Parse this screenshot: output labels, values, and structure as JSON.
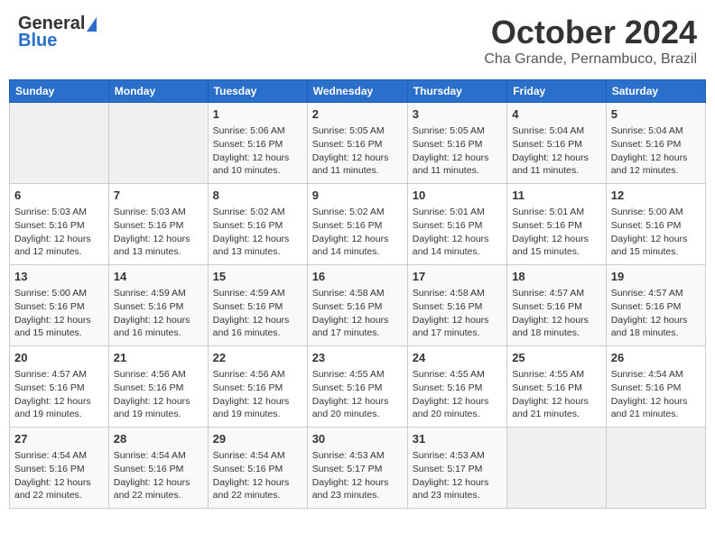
{
  "header": {
    "logo_general": "General",
    "logo_blue": "Blue",
    "month_title": "October 2024",
    "location": "Cha Grande, Pernambuco, Brazil"
  },
  "days_of_week": [
    "Sunday",
    "Monday",
    "Tuesday",
    "Wednesday",
    "Thursday",
    "Friday",
    "Saturday"
  ],
  "weeks": [
    [
      {
        "day": "",
        "content": ""
      },
      {
        "day": "",
        "content": ""
      },
      {
        "day": "1",
        "sunrise": "5:06 AM",
        "sunset": "5:16 PM",
        "daylight": "12 hours and 10 minutes."
      },
      {
        "day": "2",
        "sunrise": "5:05 AM",
        "sunset": "5:16 PM",
        "daylight": "12 hours and 11 minutes."
      },
      {
        "day": "3",
        "sunrise": "5:05 AM",
        "sunset": "5:16 PM",
        "daylight": "12 hours and 11 minutes."
      },
      {
        "day": "4",
        "sunrise": "5:04 AM",
        "sunset": "5:16 PM",
        "daylight": "12 hours and 11 minutes."
      },
      {
        "day": "5",
        "sunrise": "5:04 AM",
        "sunset": "5:16 PM",
        "daylight": "12 hours and 12 minutes."
      }
    ],
    [
      {
        "day": "6",
        "sunrise": "5:03 AM",
        "sunset": "5:16 PM",
        "daylight": "12 hours and 12 minutes."
      },
      {
        "day": "7",
        "sunrise": "5:03 AM",
        "sunset": "5:16 PM",
        "daylight": "12 hours and 13 minutes."
      },
      {
        "day": "8",
        "sunrise": "5:02 AM",
        "sunset": "5:16 PM",
        "daylight": "12 hours and 13 minutes."
      },
      {
        "day": "9",
        "sunrise": "5:02 AM",
        "sunset": "5:16 PM",
        "daylight": "12 hours and 14 minutes."
      },
      {
        "day": "10",
        "sunrise": "5:01 AM",
        "sunset": "5:16 PM",
        "daylight": "12 hours and 14 minutes."
      },
      {
        "day": "11",
        "sunrise": "5:01 AM",
        "sunset": "5:16 PM",
        "daylight": "12 hours and 15 minutes."
      },
      {
        "day": "12",
        "sunrise": "5:00 AM",
        "sunset": "5:16 PM",
        "daylight": "12 hours and 15 minutes."
      }
    ],
    [
      {
        "day": "13",
        "sunrise": "5:00 AM",
        "sunset": "5:16 PM",
        "daylight": "12 hours and 15 minutes."
      },
      {
        "day": "14",
        "sunrise": "4:59 AM",
        "sunset": "5:16 PM",
        "daylight": "12 hours and 16 minutes."
      },
      {
        "day": "15",
        "sunrise": "4:59 AM",
        "sunset": "5:16 PM",
        "daylight": "12 hours and 16 minutes."
      },
      {
        "day": "16",
        "sunrise": "4:58 AM",
        "sunset": "5:16 PM",
        "daylight": "12 hours and 17 minutes."
      },
      {
        "day": "17",
        "sunrise": "4:58 AM",
        "sunset": "5:16 PM",
        "daylight": "12 hours and 17 minutes."
      },
      {
        "day": "18",
        "sunrise": "4:57 AM",
        "sunset": "5:16 PM",
        "daylight": "12 hours and 18 minutes."
      },
      {
        "day": "19",
        "sunrise": "4:57 AM",
        "sunset": "5:16 PM",
        "daylight": "12 hours and 18 minutes."
      }
    ],
    [
      {
        "day": "20",
        "sunrise": "4:57 AM",
        "sunset": "5:16 PM",
        "daylight": "12 hours and 19 minutes."
      },
      {
        "day": "21",
        "sunrise": "4:56 AM",
        "sunset": "5:16 PM",
        "daylight": "12 hours and 19 minutes."
      },
      {
        "day": "22",
        "sunrise": "4:56 AM",
        "sunset": "5:16 PM",
        "daylight": "12 hours and 19 minutes."
      },
      {
        "day": "23",
        "sunrise": "4:55 AM",
        "sunset": "5:16 PM",
        "daylight": "12 hours and 20 minutes."
      },
      {
        "day": "24",
        "sunrise": "4:55 AM",
        "sunset": "5:16 PM",
        "daylight": "12 hours and 20 minutes."
      },
      {
        "day": "25",
        "sunrise": "4:55 AM",
        "sunset": "5:16 PM",
        "daylight": "12 hours and 21 minutes."
      },
      {
        "day": "26",
        "sunrise": "4:54 AM",
        "sunset": "5:16 PM",
        "daylight": "12 hours and 21 minutes."
      }
    ],
    [
      {
        "day": "27",
        "sunrise": "4:54 AM",
        "sunset": "5:16 PM",
        "daylight": "12 hours and 22 minutes."
      },
      {
        "day": "28",
        "sunrise": "4:54 AM",
        "sunset": "5:16 PM",
        "daylight": "12 hours and 22 minutes."
      },
      {
        "day": "29",
        "sunrise": "4:54 AM",
        "sunset": "5:16 PM",
        "daylight": "12 hours and 22 minutes."
      },
      {
        "day": "30",
        "sunrise": "4:53 AM",
        "sunset": "5:17 PM",
        "daylight": "12 hours and 23 minutes."
      },
      {
        "day": "31",
        "sunrise": "4:53 AM",
        "sunset": "5:17 PM",
        "daylight": "12 hours and 23 minutes."
      },
      {
        "day": "",
        "content": ""
      },
      {
        "day": "",
        "content": ""
      }
    ]
  ],
  "labels": {
    "sunrise": "Sunrise:",
    "sunset": "Sunset:",
    "daylight": "Daylight:"
  }
}
